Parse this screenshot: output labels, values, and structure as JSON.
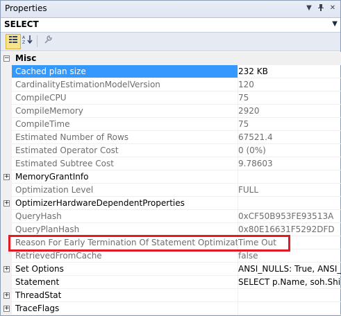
{
  "window": {
    "title": "Properties"
  },
  "selector": {
    "value": "SELECT"
  },
  "category": {
    "label": "Misc"
  },
  "rows": [
    {
      "name": "Cached plan size",
      "value": "232 KB"
    },
    {
      "name": "CardinalityEstimationModelVersion",
      "value": "120"
    },
    {
      "name": "CompileCPU",
      "value": "75"
    },
    {
      "name": "CompileMemory",
      "value": "2920"
    },
    {
      "name": "CompileTime",
      "value": "75"
    },
    {
      "name": "Estimated Number of Rows",
      "value": "67521.4"
    },
    {
      "name": "Estimated Operator Cost",
      "value": "0 (0%)"
    },
    {
      "name": "Estimated Subtree Cost",
      "value": "9.78603"
    },
    {
      "name": "MemoryGrantInfo",
      "value": ""
    },
    {
      "name": "Optimization Level",
      "value": "FULL"
    },
    {
      "name": "OptimizerHardwareDependentProperties",
      "value": ""
    },
    {
      "name": "QueryHash",
      "value": "0xCF50B953FE93513A"
    },
    {
      "name": "QueryPlanHash",
      "value": "0x80E16631F5292DFD"
    },
    {
      "name": "Reason For Early Termination Of Statement Optimization",
      "value": "Time Out"
    },
    {
      "name": "RetrievedFromCache",
      "value": "false"
    },
    {
      "name": "Set Options",
      "value": "ANSI_NULLS: True, ANSI_PA"
    },
    {
      "name": "Statement",
      "value": "SELECT p.Name, soh.ShipDa"
    },
    {
      "name": "ThreadStat",
      "value": ""
    },
    {
      "name": "TraceFlags",
      "value": ""
    }
  ],
  "colors": {
    "selection": "#3399ff",
    "highlight_box": "#e01b24"
  }
}
